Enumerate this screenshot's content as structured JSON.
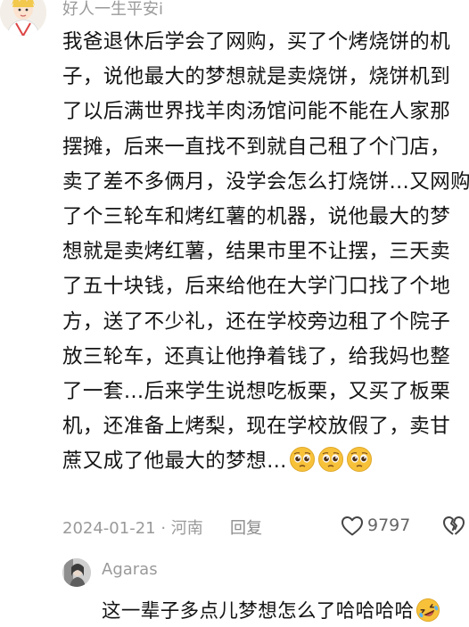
{
  "main_comment": {
    "username": "好人一生平安i",
    "lines": [
      "我爸退休后学会了网购，买了个烤烧饼的机",
      "子，说他最大的梦想就是卖烧饼，烧饼机到",
      "了以后满世界找羊肉汤馆问能不能在人家那",
      "摆摊，后来一直找不到就自己租了个门店，",
      "卖了差不多俩月，没学会怎么打烧饼…又网购",
      "了个三轮车和烤红薯的机器，说他最大的梦",
      "想就是卖烤红薯，结果市里不让摆，三天卖",
      "了五十块钱，后来给他在大学门口找了个地",
      "方，送了不少礼，还在学校旁边租了个院子",
      "放三轮车，还真让他挣着钱了，给我妈也整",
      "了一套…后来学生说想吃板栗，又买了板栗",
      "机，还准备上烤梨，现在学校放假了，卖甘",
      "蔗又成了他最大的梦想…"
    ],
    "trailing_emojis": [
      "pleading-face-emoji",
      "pleading-face-emoji",
      "pleading-face-emoji"
    ],
    "date_location": "2024-01-21 · 河南",
    "reply_label": "回复",
    "like_count": "9797",
    "icons": {
      "like": "heart-outline-icon",
      "dislike": "broken-heart-outline-icon"
    }
  },
  "reply_comment": {
    "username": "Agaras",
    "text": "这一辈子多点儿梦想怎么了哈哈哈哈",
    "trailing_emoji": "rolling-on-floor-laughing-emoji"
  },
  "colors": {
    "text_primary": "#141414",
    "text_secondary": "#9a9a9a",
    "emoji_yellow": "#f7c23a",
    "background": "#ffffff"
  }
}
